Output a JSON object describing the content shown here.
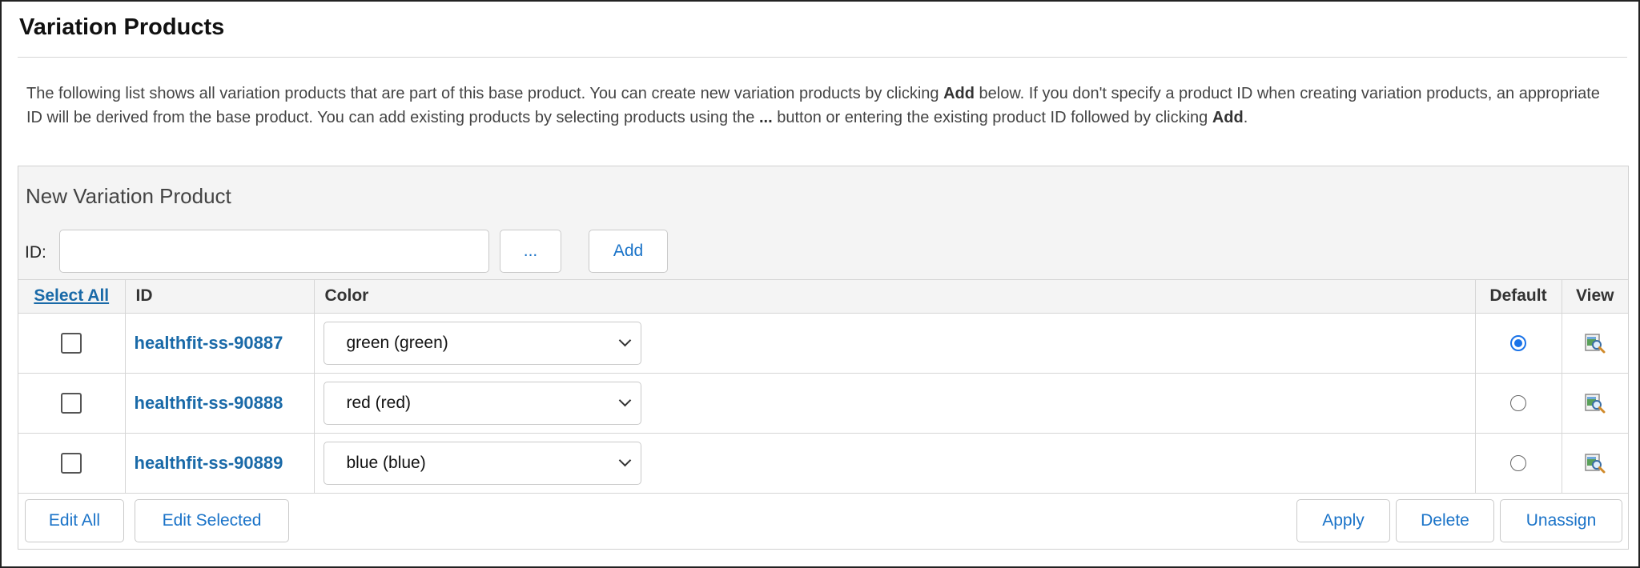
{
  "page": {
    "title": "Variation Products",
    "description": {
      "part1": "The following list shows all variation products that are part of this base product. You can create new variation products by clicking ",
      "add_word": "Add",
      "part2": " below. If you don't specify a product ID when creating variation products, an appropriate ID will be derived from the base product. You can add existing products by selecting products using the ",
      "ellipsis_word": "...",
      "part3": " button or entering the existing product ID followed by clicking ",
      "add_word2": "Add",
      "part4": "."
    }
  },
  "new_variation": {
    "title": "New Variation Product",
    "id_label": "ID:",
    "id_value": "",
    "browse_label": "...",
    "add_label": "Add"
  },
  "table": {
    "headers": {
      "select_all": "Select All",
      "id": "ID",
      "color": "Color",
      "default": "Default",
      "view": "View"
    },
    "rows": [
      {
        "id": "healthfit-ss-90887",
        "color": "green (green)",
        "checked": false,
        "default": true,
        "view_icon": "view-product-icon"
      },
      {
        "id": "healthfit-ss-90888",
        "color": "red (red)",
        "checked": false,
        "default": false,
        "view_icon": "view-product-icon"
      },
      {
        "id": "healthfit-ss-90889",
        "color": "blue (blue)",
        "checked": false,
        "default": false,
        "view_icon": "view-product-icon"
      }
    ]
  },
  "footer": {
    "edit_all": "Edit All",
    "edit_selected": "Edit Selected",
    "apply": "Apply",
    "delete": "Delete",
    "unassign": "Unassign"
  },
  "colors": {
    "link": "#1a6aa8",
    "button_text": "#1a73c8",
    "radio_selected": "#1a73e8",
    "panel_bg": "#f4f4f4"
  }
}
